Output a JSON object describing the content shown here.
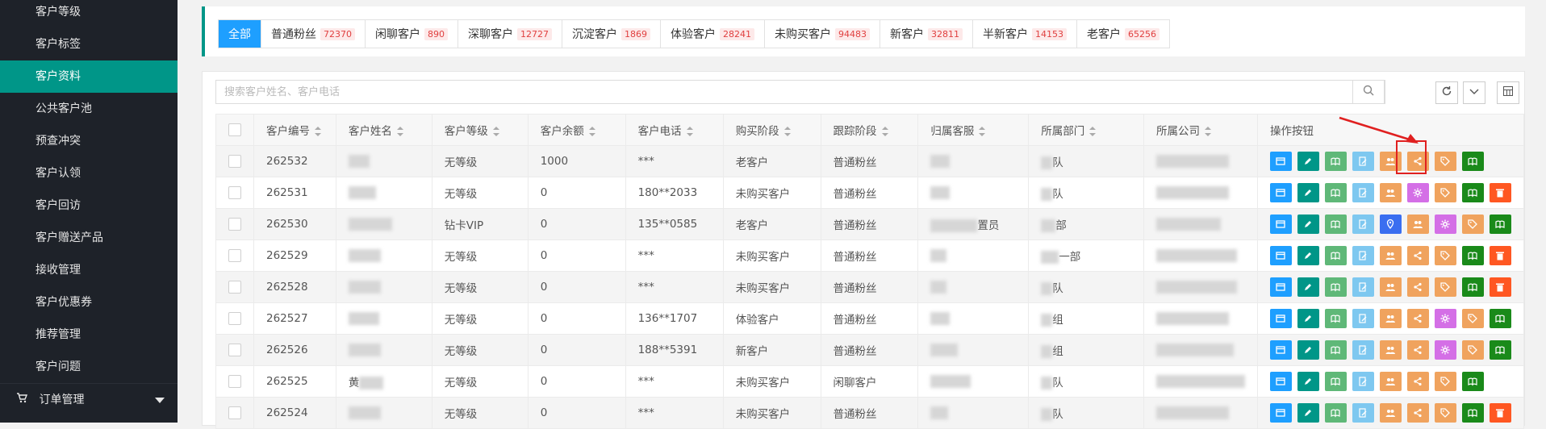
{
  "sidebar": {
    "items": [
      {
        "label": "客户等级",
        "active": false
      },
      {
        "label": "客户标签",
        "active": false
      },
      {
        "label": "客户资料",
        "active": true
      },
      {
        "label": "公共客户池",
        "active": false
      },
      {
        "label": "预查冲突",
        "active": false
      },
      {
        "label": "客户认领",
        "active": false
      },
      {
        "label": "客户回访",
        "active": false
      },
      {
        "label": "客户赠送产品",
        "active": false
      },
      {
        "label": "接收管理",
        "active": false
      },
      {
        "label": "客户优惠券",
        "active": false
      },
      {
        "label": "推荐管理",
        "active": false
      },
      {
        "label": "客户问题",
        "active": false
      }
    ],
    "order_menu": {
      "label": "订单管理",
      "icon": "cart-icon"
    }
  },
  "filter_tabs": [
    {
      "label": "全部",
      "count": null,
      "active": true
    },
    {
      "label": "普通粉丝",
      "count": "72370",
      "active": false
    },
    {
      "label": "闲聊客户",
      "count": "890",
      "active": false
    },
    {
      "label": "深聊客户",
      "count": "12727",
      "active": false
    },
    {
      "label": "沉淀客户",
      "count": "1869",
      "active": false
    },
    {
      "label": "体验客户",
      "count": "28241",
      "active": false
    },
    {
      "label": "未购买客户",
      "count": "94483",
      "active": false
    },
    {
      "label": "新客户",
      "count": "32811",
      "active": false
    },
    {
      "label": "半新客户",
      "count": "14153",
      "active": false
    },
    {
      "label": "老客户",
      "count": "65256",
      "active": false
    }
  ],
  "search": {
    "placeholder": "搜索客户姓名、客户电话",
    "icon": "search-icon"
  },
  "toolbar": {
    "refresh_icon": "refresh-icon",
    "dropdown_icon": "chevron-down-icon",
    "columns_icon": "grid-icon"
  },
  "table": {
    "columns": [
      "客户编号",
      "客户姓名",
      "客户等级",
      "客户余额",
      "客户电话",
      "购买阶段",
      "跟踪阶段",
      "归属客服",
      "所属部门",
      "所属公司",
      "操作按钮"
    ],
    "rows": [
      {
        "id": "262532",
        "name_visible": "",
        "level": "无等级",
        "balance": "1000",
        "phone": "***",
        "buy_stage": "老客户",
        "track_stage": "普通粉丝",
        "agent_visible": "",
        "dept_visible": "队",
        "company_visible": "",
        "ops": [
          "window",
          "edit",
          "book",
          "note",
          "users",
          "share",
          "tag",
          "book-dark"
        ]
      },
      {
        "id": "262531",
        "name_visible": "",
        "level": "无等级",
        "balance": "0",
        "phone": "180**2033",
        "buy_stage": "未购买客户",
        "track_stage": "普通粉丝",
        "agent_visible": "",
        "dept_visible": "队",
        "company_visible": "",
        "ops": [
          "window",
          "edit",
          "book",
          "note",
          "users",
          "gear",
          "tag",
          "book-dark",
          "trash"
        ]
      },
      {
        "id": "262530",
        "name_visible": "",
        "level": "钻卡VIP",
        "balance": "0",
        "phone": "135**0585",
        "buy_stage": "老客户",
        "track_stage": "普通粉丝",
        "agent_visible": "置员",
        "dept_visible": "部",
        "company_visible": "",
        "ops": [
          "window",
          "edit",
          "book",
          "note",
          "pin",
          "users",
          "gear",
          "tag",
          "book-dark"
        ]
      },
      {
        "id": "262529",
        "name_visible": "",
        "level": "无等级",
        "balance": "0",
        "phone": "***",
        "buy_stage": "未购买客户",
        "track_stage": "普通粉丝",
        "agent_visible": "",
        "dept_visible": "一部",
        "company_visible": "",
        "ops": [
          "window",
          "edit",
          "book",
          "note",
          "users",
          "share",
          "tag",
          "book-dark",
          "trash"
        ]
      },
      {
        "id": "262528",
        "name_visible": "",
        "level": "无等级",
        "balance": "0",
        "phone": "***",
        "buy_stage": "未购买客户",
        "track_stage": "普通粉丝",
        "agent_visible": "",
        "dept_visible": "队",
        "company_visible": "",
        "ops": [
          "window",
          "edit",
          "book",
          "note",
          "users",
          "share",
          "tag",
          "book-dark",
          "trash"
        ]
      },
      {
        "id": "262527",
        "name_visible": "",
        "level": "无等级",
        "balance": "0",
        "phone": "136**1707",
        "buy_stage": "体验客户",
        "track_stage": "普通粉丝",
        "agent_visible": "",
        "dept_visible": "组",
        "company_visible": "",
        "ops": [
          "window",
          "edit",
          "book",
          "note",
          "users",
          "share",
          "gear",
          "tag",
          "book-dark"
        ]
      },
      {
        "id": "262526",
        "name_visible": "",
        "level": "无等级",
        "balance": "0",
        "phone": "188**5391",
        "buy_stage": "新客户",
        "track_stage": "普通粉丝",
        "agent_visible": "",
        "dept_visible": "组",
        "company_visible": "",
        "ops": [
          "window",
          "edit",
          "book",
          "note",
          "users",
          "share",
          "gear",
          "tag",
          "book-dark"
        ]
      },
      {
        "id": "262525",
        "name_visible": "黄",
        "level": "无等级",
        "balance": "0",
        "phone": "***",
        "buy_stage": "未购买客户",
        "track_stage": "闲聊客户",
        "agent_visible": "",
        "dept_visible": "队",
        "company_visible": "",
        "ops": [
          "window",
          "edit",
          "book",
          "note",
          "users",
          "share",
          "tag",
          "book-dark"
        ]
      },
      {
        "id": "262524",
        "name_visible": "",
        "level": "无等级",
        "balance": "0",
        "phone": "***",
        "buy_stage": "未购买客户",
        "track_stage": "普通粉丝",
        "agent_visible": "",
        "dept_visible": "队",
        "company_visible": "",
        "ops": [
          "window",
          "edit",
          "book",
          "note",
          "users",
          "share",
          "tag",
          "book-dark",
          "trash"
        ]
      }
    ]
  },
  "colors": {
    "sidebar_bg": "#1e2229",
    "active_green": "#009688",
    "active_blue": "#1e9fff",
    "op_window": "#1e9fff",
    "op_edit": "#009688",
    "op_book": "#5fb878",
    "op_note": "#7ec8f0",
    "op_users": "#f0a35e",
    "op_share": "#f0a35e",
    "op_gear": "#d46fe6",
    "op_tag": "#f0a35e",
    "op_book_dark": "#1a8a1a",
    "op_trash": "#ff5722",
    "op_pin": "#3a6ef0",
    "annotation": "#e02020"
  }
}
